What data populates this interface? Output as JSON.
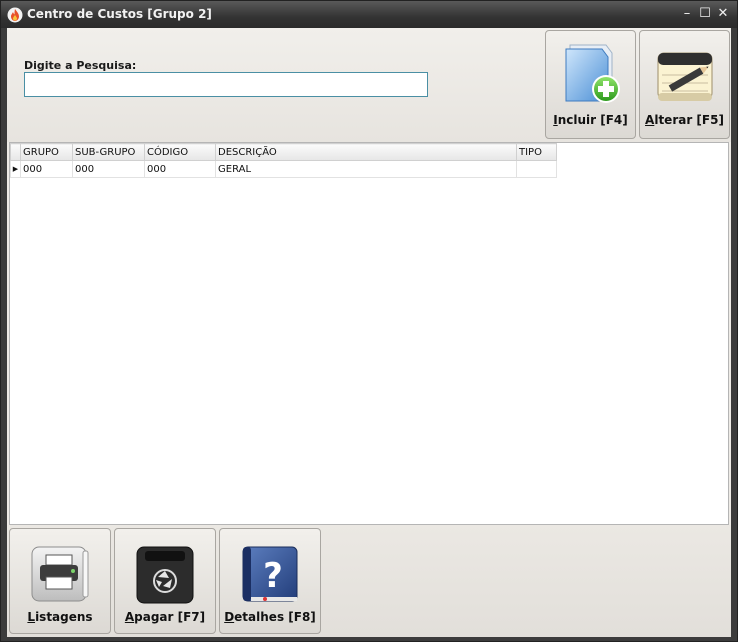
{
  "window": {
    "title": "Centro de Custos [Grupo 2]",
    "minimize": "–",
    "maximize": "☐",
    "close": "✕"
  },
  "search": {
    "label": "Digite a Pesquisa:",
    "value": "",
    "placeholder": ""
  },
  "toolbar": {
    "incluir": {
      "key": "I",
      "rest": "ncluir [F4]",
      "icon": "folder-add-icon"
    },
    "alterar": {
      "key": "A",
      "rest": "lterar [F5]",
      "icon": "notepad-pencil-icon"
    }
  },
  "grid": {
    "columns": [
      "GRUPO",
      "SUB-GRUPO",
      "CÓDIGO",
      "DESCRIÇÃO",
      "TIPO"
    ],
    "rows": [
      {
        "grupo": "000",
        "sub_grupo": "000",
        "codigo": "000",
        "descricao": "GERAL",
        "tipo": ""
      }
    ],
    "row_indicator": "▶"
  },
  "bottom": {
    "listagens": {
      "key": "L",
      "rest": "istagens",
      "icon": "printer-icon"
    },
    "apagar": {
      "key": "A",
      "rest": "pagar [F7]",
      "icon": "recycle-bin-icon"
    },
    "detalhes": {
      "key": "D",
      "rest": "etalhes [F8]",
      "icon": "help-book-icon"
    }
  }
}
